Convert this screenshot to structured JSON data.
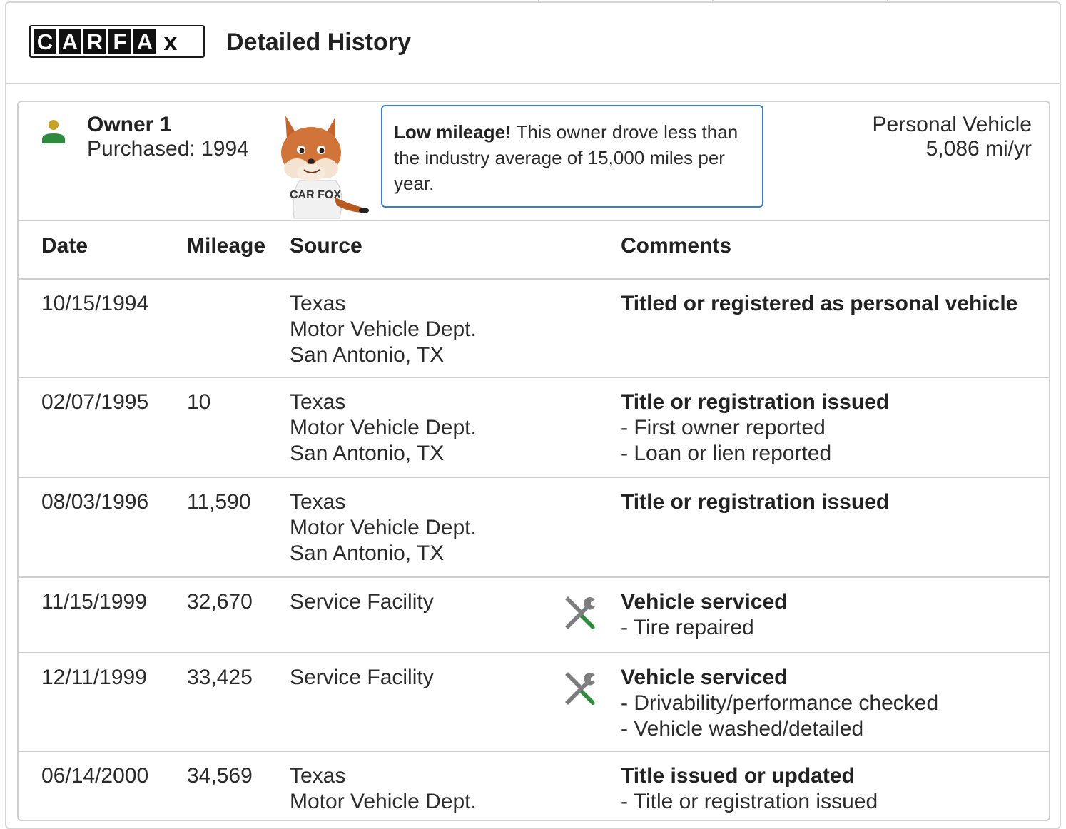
{
  "header": {
    "logo_letters": [
      "C",
      "A",
      "R",
      "F",
      "A",
      "X"
    ],
    "title": "Detailed History"
  },
  "owner": {
    "title": "Owner 1",
    "purchased": "Purchased: 1994",
    "callout_strong": "Low mileage!",
    "callout_text": " This owner drove less than the industry average of 15,000 miles per year.",
    "vehicle_type": "Personal Vehicle",
    "mileage_rate": "5,086 mi/yr",
    "fox_shirt": "CAR FOX"
  },
  "table": {
    "headers": [
      "Date",
      "Mileage",
      "Source",
      "Comments"
    ],
    "rows": [
      {
        "date": "10/15/1994",
        "mileage": "",
        "source": [
          "Texas",
          "Motor Vehicle Dept.",
          "San Antonio, TX"
        ],
        "comment_title": "Titled or registered as personal vehicle",
        "comment_items": [],
        "icon": ""
      },
      {
        "date": "02/07/1995",
        "mileage": "10",
        "source": [
          "Texas",
          "Motor Vehicle Dept.",
          "San Antonio, TX"
        ],
        "comment_title": "Title or registration issued",
        "comment_items": [
          "- First owner reported",
          "- Loan or lien reported"
        ],
        "icon": ""
      },
      {
        "date": "08/03/1996",
        "mileage": "11,590",
        "source": [
          "Texas",
          "Motor Vehicle Dept.",
          "San Antonio, TX"
        ],
        "comment_title": "Title or registration issued",
        "comment_items": [],
        "icon": ""
      },
      {
        "date": "11/15/1999",
        "mileage": "32,670",
        "source": [
          "Service Facility"
        ],
        "comment_title": "Vehicle serviced",
        "comment_items": [
          "- Tire repaired"
        ],
        "icon": "wrench-screwdriver-icon"
      },
      {
        "date": "12/11/1999",
        "mileage": "33,425",
        "source": [
          "Service Facility"
        ],
        "comment_title": "Vehicle serviced",
        "comment_items": [
          "- Drivability/performance checked",
          "- Vehicle washed/detailed"
        ],
        "icon": "wrench-screwdriver-icon"
      },
      {
        "date": "06/14/2000",
        "mileage": "34,569",
        "source": [
          "Texas",
          "Motor Vehicle Dept."
        ],
        "comment_title": "Title issued or updated",
        "comment_items": [
          "- Title or registration issued"
        ],
        "icon": ""
      }
    ]
  },
  "colors": {
    "border": "#cfcfcf",
    "callout_border": "#3a7bd5",
    "owner_icon_head": "#c9a227",
    "owner_icon_body": "#2e8b3d",
    "wrench_gray": "#7d7d7d",
    "screwdriver_green": "#2e8b3d"
  }
}
